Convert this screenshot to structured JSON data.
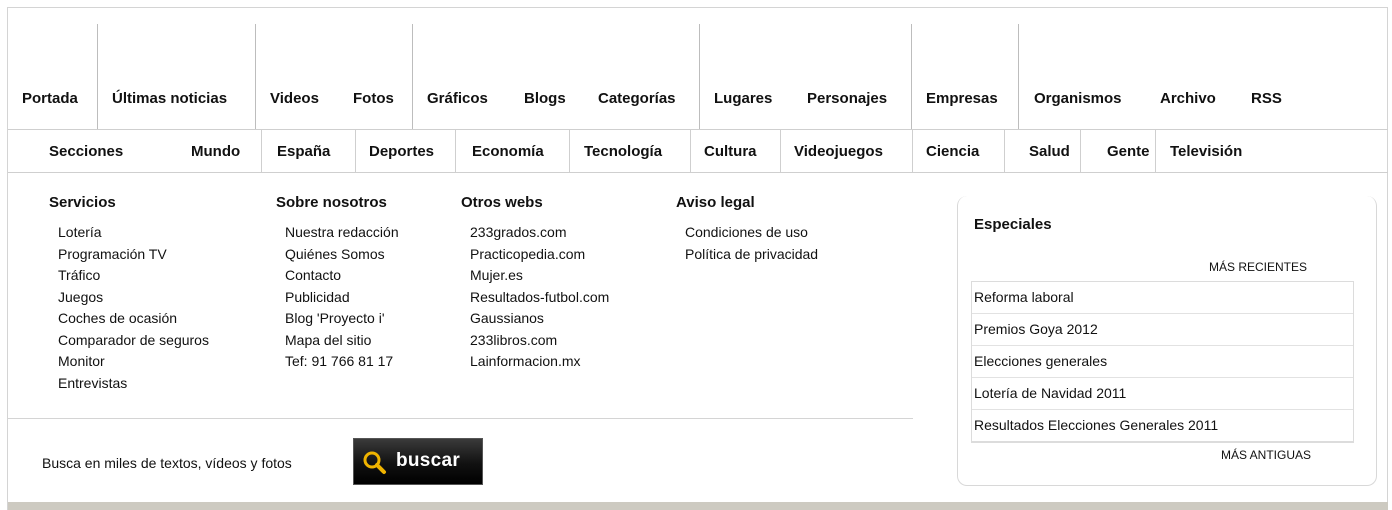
{
  "top_nav": [
    "Portada",
    "Últimas noticias",
    "Videos",
    "Fotos",
    "Gráficos",
    "Blogs",
    "Categorías",
    "Lugares",
    "Personajes",
    "Empresas",
    "Organismos",
    "Archivo",
    "RSS"
  ],
  "sections": [
    "Secciones",
    "Mundo",
    "España",
    "Deportes",
    "Economía",
    "Tecnología",
    "Cultura",
    "Videojuegos",
    "Ciencia",
    "Salud",
    "Gente",
    "Televisión"
  ],
  "columns": [
    {
      "heading": "Servicios",
      "links": [
        "Lotería",
        "Programación TV",
        "Tráfico",
        "Juegos",
        "Coches de ocasión",
        "Comparador de seguros",
        "Monitor",
        "Entrevistas"
      ]
    },
    {
      "heading": "Sobre nosotros",
      "links": [
        "Nuestra redacción",
        "Quiénes Somos",
        "Contacto",
        "Publicidad",
        "Blog 'Proyecto i'",
        "Mapa del sitio",
        "Tef: 91 766 81 17"
      ]
    },
    {
      "heading": "Otros webs",
      "links": [
        "233grados.com",
        "Practicopedia.com",
        "Mujer.es",
        "Resultados-futbol.com",
        "Gaussianos",
        "233libros.com",
        "Lainformacion.mx"
      ]
    },
    {
      "heading": "Aviso legal",
      "links": [
        "Condiciones de uso",
        "Política de privacidad"
      ]
    }
  ],
  "search": {
    "text": "Busca en miles de textos, vídeos y fotos",
    "button_label": "buscar",
    "icon": "search-icon"
  },
  "especiales": {
    "title": "Especiales",
    "recent_label": "MÁS RECIENTES",
    "older_label": "MÁS ANTIGUAS",
    "items": [
      "Reforma laboral",
      "Premios Goya 2012",
      "Elecciones generales",
      "Lotería de Navidad 2011",
      "Resultados Elecciones Generales 2011"
    ]
  },
  "colors": {
    "search_icon": "#f0b400",
    "bottom_bar": "#cdcac1"
  }
}
